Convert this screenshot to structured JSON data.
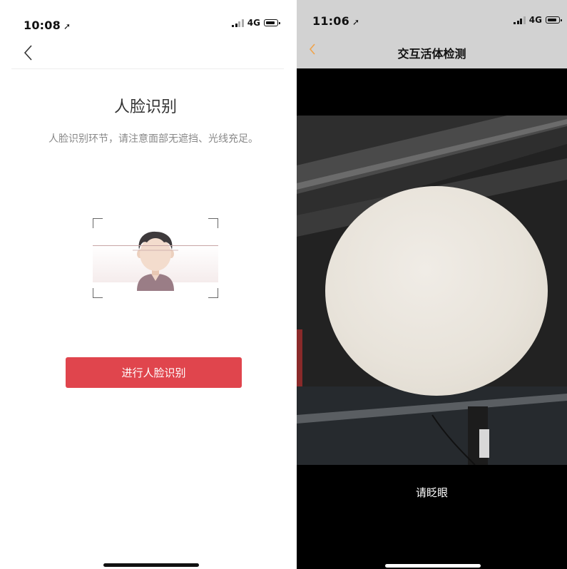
{
  "left_screen": {
    "status": {
      "time": "10:08",
      "network": "4G"
    },
    "title": "人脸识别",
    "description": "人脸识别环节，请注意面部无遮挡、光线充足。",
    "start_button": "进行人脸识别"
  },
  "right_screen": {
    "status": {
      "time": "11:06",
      "network": "4G"
    },
    "nav_title": "交互活体检测",
    "prompt": "请眨眼",
    "accent_color": "#f0a34a"
  },
  "colors": {
    "primary_button": "#e0454d",
    "status_bar_right": "#d2d2d2"
  },
  "icons": [
    "location-arrow-icon",
    "signal-icon",
    "battery-icon",
    "back-chevron-icon",
    "face-avatar-icon"
  ]
}
